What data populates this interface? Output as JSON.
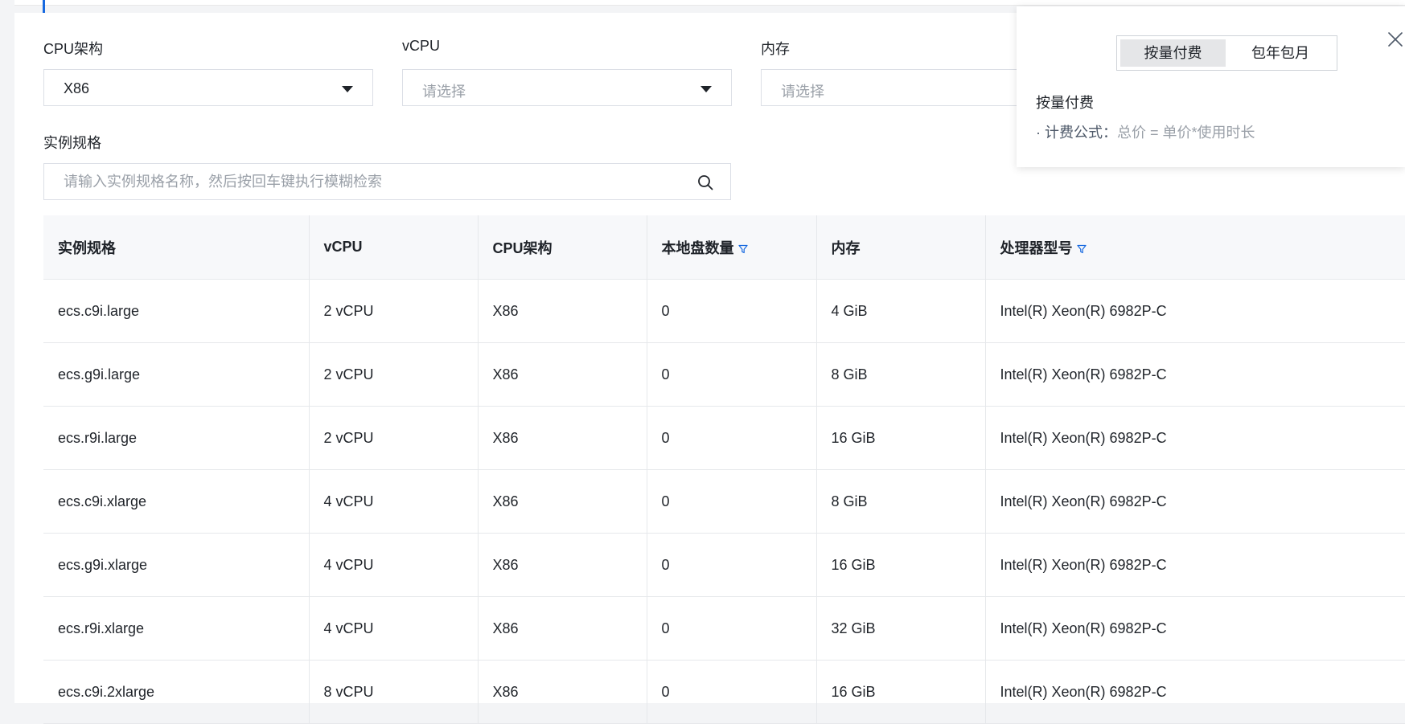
{
  "filters": {
    "cpu_arch": {
      "label": "CPU架构",
      "value": "X86"
    },
    "vcpu": {
      "label": "vCPU",
      "placeholder": "请选择"
    },
    "memory": {
      "label": "内存",
      "placeholder": "请选择"
    },
    "instance_spec": {
      "label": "实例规格",
      "placeholder": "请输入实例规格名称，然后按回车键执行模糊检索"
    }
  },
  "table": {
    "columns": [
      "实例规格",
      "vCPU",
      "CPU架构",
      "本地盘数量",
      "内存",
      "处理器型号"
    ],
    "rows": [
      [
        "ecs.c9i.large",
        "2 vCPU",
        "X86",
        "0",
        "4 GiB",
        "Intel(R) Xeon(R) 6982P-C"
      ],
      [
        "ecs.g9i.large",
        "2 vCPU",
        "X86",
        "0",
        "8 GiB",
        "Intel(R) Xeon(R) 6982P-C"
      ],
      [
        "ecs.r9i.large",
        "2 vCPU",
        "X86",
        "0",
        "16 GiB",
        "Intel(R) Xeon(R) 6982P-C"
      ],
      [
        "ecs.c9i.xlarge",
        "4 vCPU",
        "X86",
        "0",
        "8 GiB",
        "Intel(R) Xeon(R) 6982P-C"
      ],
      [
        "ecs.g9i.xlarge",
        "4 vCPU",
        "X86",
        "0",
        "16 GiB",
        "Intel(R) Xeon(R) 6982P-C"
      ],
      [
        "ecs.r9i.xlarge",
        "4 vCPU",
        "X86",
        "0",
        "32 GiB",
        "Intel(R) Xeon(R) 6982P-C"
      ],
      [
        "ecs.c9i.2xlarge",
        "8 vCPU",
        "X86",
        "0",
        "16 GiB",
        "Intel(R) Xeon(R) 6982P-C"
      ]
    ]
  },
  "popover": {
    "tabs": [
      "按量付费",
      "包年包月"
    ],
    "active_tab": 0,
    "title": "按量付费",
    "formula_key": "· 计费公式：",
    "formula_value": "总价 = 单价*使用时长"
  },
  "colors": {
    "accent": "#1769e0",
    "filter_icon": "#1769e0"
  },
  "icons": {
    "search": "search-icon",
    "close": "close-icon",
    "dropdown": "chevron-down-icon",
    "filter": "filter-icon"
  }
}
